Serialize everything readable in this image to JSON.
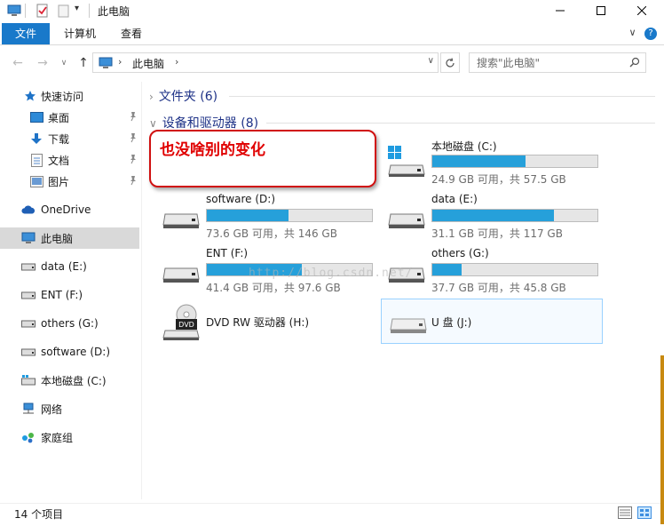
{
  "window": {
    "title": "此电脑"
  },
  "ribbon": {
    "tabs": [
      "文件",
      "计算机",
      "查看"
    ]
  },
  "address": {
    "path": "此电脑"
  },
  "search": {
    "placeholder": "搜索\"此电脑\""
  },
  "sidebar": {
    "items": [
      {
        "label": "快速访问",
        "icon": "star-icon"
      },
      {
        "label": "桌面",
        "icon": "desktop-icon",
        "pinned": true
      },
      {
        "label": "下载",
        "icon": "download-icon",
        "pinned": true
      },
      {
        "label": "文档",
        "icon": "document-icon",
        "pinned": true
      },
      {
        "label": "图片",
        "icon": "picture-icon",
        "pinned": true
      },
      {
        "label": "OneDrive",
        "icon": "cloud-icon"
      },
      {
        "label": "此电脑",
        "icon": "computer-icon",
        "selected": true
      },
      {
        "label": "data (E:)",
        "icon": "drive-icon"
      },
      {
        "label": "ENT (F:)",
        "icon": "drive-icon"
      },
      {
        "label": "others (G:)",
        "icon": "drive-icon"
      },
      {
        "label": "software (D:)",
        "icon": "drive-icon"
      },
      {
        "label": "本地磁盘 (C:)",
        "icon": "windows-drive-icon"
      },
      {
        "label": "网络",
        "icon": "network-icon"
      },
      {
        "label": "家庭组",
        "icon": "homegroup-icon"
      }
    ]
  },
  "groups": {
    "folders": "文件夹 (6)",
    "devices": "设备和驱动器 (8)"
  },
  "drives": [
    {
      "name": "本地磁盘 (C:)",
      "status": "24.9 GB 可用，共 57.5 GB",
      "used_fraction": 0.567
    },
    {
      "name": "software (D:)",
      "status": "73.6 GB 可用，共 146 GB",
      "used_fraction": 0.496
    },
    {
      "name": "data (E:)",
      "status": "31.1 GB 可用，共 117 GB",
      "used_fraction": 0.734
    },
    {
      "name": "ENT (F:)",
      "status": "41.4 GB 可用，共 97.6 GB",
      "used_fraction": 0.576
    },
    {
      "name": "others (G:)",
      "status": "37.7 GB 可用，共 45.8 GB",
      "used_fraction": 0.177
    },
    {
      "name": "DVD RW 驱动器 (H:)"
    },
    {
      "name": "U 盘 (J:)"
    }
  ],
  "annotation": "也没啥别的变化",
  "watermark": "http://blog.csdn.net/",
  "status": {
    "count": "14 个项目"
  },
  "colors": {
    "accent": "#1979ca",
    "bar_fill": "#26a0da",
    "annotation_red": "#e00000"
  }
}
